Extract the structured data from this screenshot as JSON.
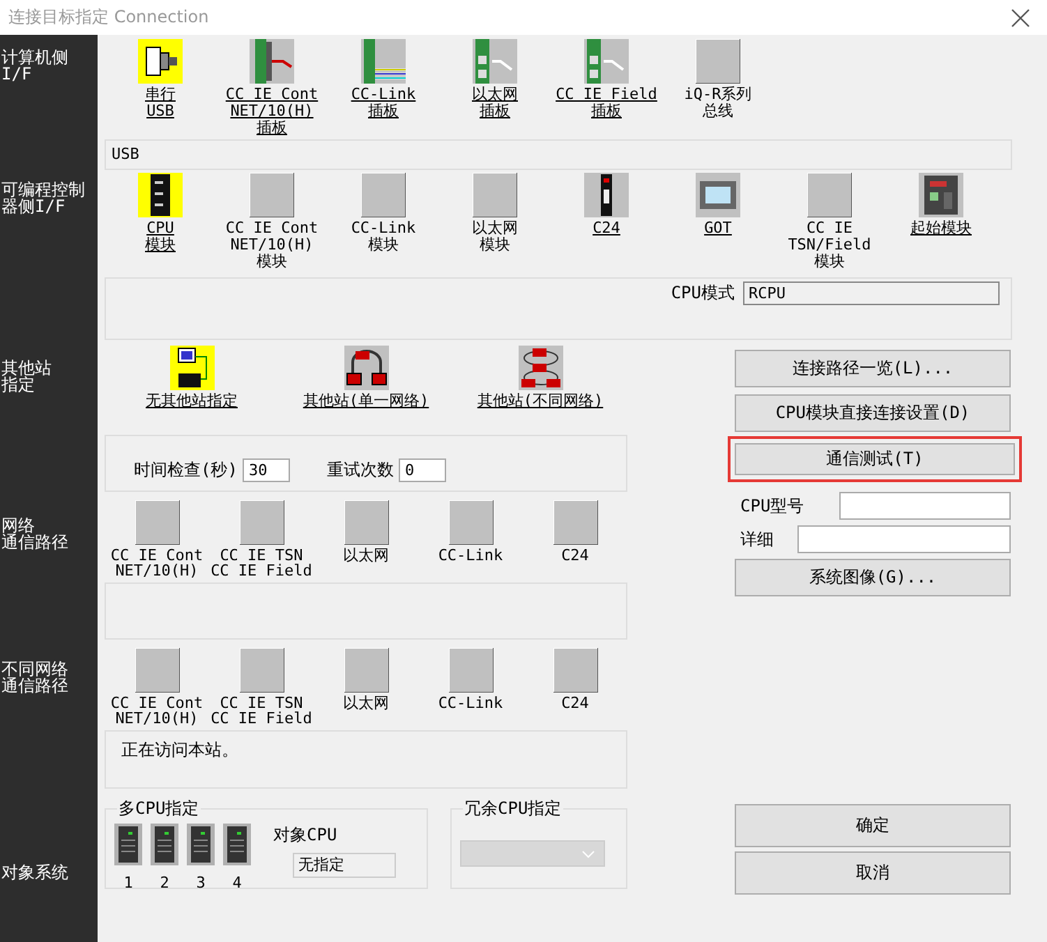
{
  "window": {
    "title": "连接目标指定 Connection"
  },
  "sidebar": [
    [
      "计算机侧",
      "I/F"
    ],
    [
      "可编程控制",
      "器侧I/F"
    ],
    [
      "其他站",
      "指定"
    ],
    [
      "网络",
      "通信路径"
    ],
    [
      "不同网络",
      "通信路径"
    ],
    [
      "对象系统"
    ]
  ],
  "pc_side": {
    "items": [
      {
        "lines": [
          "串行",
          "USB"
        ],
        "kind": "serial",
        "selected": true,
        "enabled": true
      },
      {
        "lines": [
          "CC IE Cont",
          "NET/10(H)",
          "插板"
        ],
        "kind": "board-cable",
        "selected": false,
        "enabled": true
      },
      {
        "lines": [
          "CC-Link",
          "插板"
        ],
        "kind": "board-wires",
        "selected": false,
        "enabled": true
      },
      {
        "lines": [
          "以太网",
          "插板"
        ],
        "kind": "board-ethernet",
        "selected": false,
        "enabled": true
      },
      {
        "lines": [
          "CC IE Field",
          "插板"
        ],
        "kind": "board-ethernet",
        "selected": false,
        "enabled": true
      },
      {
        "lines": [
          "iQ-R系列",
          "总线"
        ],
        "kind": "blank",
        "selected": false,
        "enabled": false
      }
    ],
    "value": "USB"
  },
  "plc_side": {
    "items": [
      {
        "lines": [
          "CPU",
          "模块"
        ],
        "kind": "cpu",
        "selected": true,
        "enabled": true
      },
      {
        "lines": [
          "CC IE Cont",
          "NET/10(H)",
          "模块"
        ],
        "kind": "blank",
        "selected": false,
        "enabled": false
      },
      {
        "lines": [
          "CC-Link",
          "模块"
        ],
        "kind": "blank",
        "selected": false,
        "enabled": false
      },
      {
        "lines": [
          "以太网",
          "模块"
        ],
        "kind": "blank",
        "selected": false,
        "enabled": false
      },
      {
        "lines": [
          "C24"
        ],
        "kind": "c24",
        "selected": false,
        "enabled": true
      },
      {
        "lines": [
          "GOT"
        ],
        "kind": "got",
        "selected": false,
        "enabled": true
      },
      {
        "lines": [
          "CC IE",
          "TSN/Field",
          "模块"
        ],
        "kind": "blank",
        "selected": false,
        "enabled": false
      },
      {
        "lines": [
          "起始模块"
        ],
        "kind": "start",
        "selected": false,
        "enabled": true
      }
    ],
    "cpu_mode_label": "CPU模式",
    "cpu_mode_value": "RCPU"
  },
  "other_station": {
    "items": [
      {
        "label": "无其他站指定",
        "kind": "none-station",
        "selected": true
      },
      {
        "label": "其他站(单一网络)",
        "kind": "single-net",
        "selected": false
      },
      {
        "label": "其他站(不同网络)",
        "kind": "multi-net",
        "selected": false
      }
    ]
  },
  "timing": {
    "time_label": "时间检查(秒)",
    "time_value": "30",
    "retry_label": "重试次数",
    "retry_value": "0"
  },
  "network_route": {
    "items": [
      {
        "label": "CC IE Cont\nNET/10(H)"
      },
      {
        "label": "CC IE TSN\nCC IE Field"
      },
      {
        "label": "以太网"
      },
      {
        "label": "CC-Link"
      },
      {
        "label": "C24"
      }
    ]
  },
  "diff_network_route": {
    "items": [
      {
        "label": "CC IE Cont\nNET/10(H)"
      },
      {
        "label": "CC IE TSN\nCC IE Field"
      },
      {
        "label": "以太网"
      },
      {
        "label": "CC-Link"
      },
      {
        "label": "C24"
      }
    ]
  },
  "message": "正在访问本站。",
  "multi_cpu": {
    "title": "多CPU指定",
    "cpus": [
      "1",
      "2",
      "3",
      "4"
    ],
    "target_label": "对象CPU",
    "target_value": "无指定"
  },
  "redundant": {
    "title": "冗余CPU指定",
    "disabled": true
  },
  "buttons": [
    {
      "label": "连接路径一览(L)...",
      "highlighted": false
    },
    {
      "label": "CPU模块直接连接设置(D)",
      "highlighted": false
    },
    {
      "label": "通信测试(T)",
      "highlighted": true
    }
  ],
  "cpu_model_label": "CPU型号",
  "detail_label": "详细",
  "system_image_button": "系统图像(G)...",
  "dialog_buttons": [
    "确定",
    "取消"
  ]
}
